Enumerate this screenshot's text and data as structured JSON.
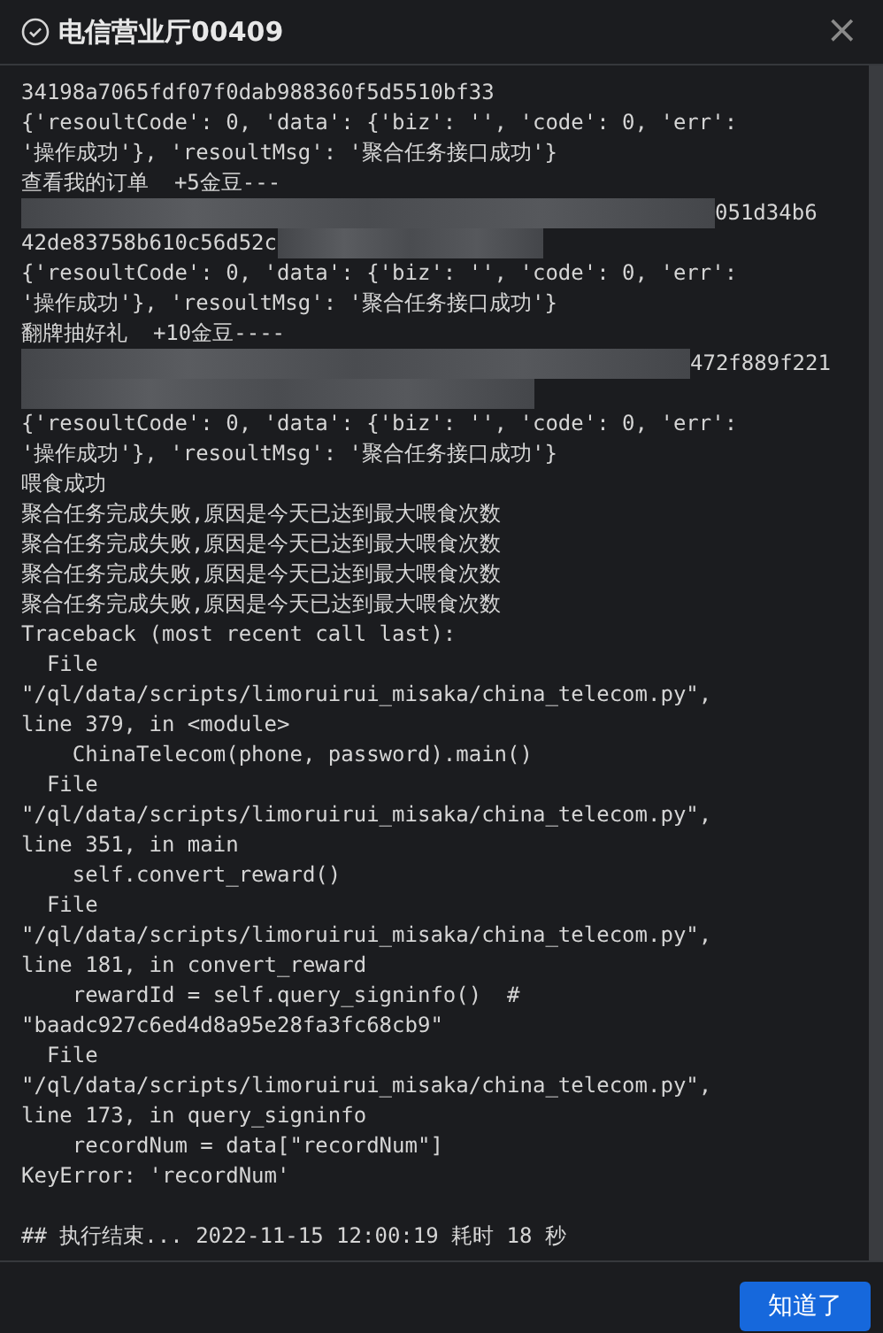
{
  "dialog": {
    "title": "电信营业厅00409",
    "close": "×"
  },
  "log": [
    {
      "kind": "text",
      "text": "34198a7065fdf07f0dab988360f5d5510bf33"
    },
    {
      "kind": "text",
      "text": "{'resoultCode': 0, 'data': {'biz': '', 'code': 0, 'err':"
    },
    {
      "kind": "text",
      "text": "'操作成功'}, 'resoultMsg': '聚合任务接口成功'}"
    },
    {
      "kind": "text",
      "text": "查看我的订单  +5金豆---"
    },
    {
      "kind": "redacted",
      "after": "051d34b6"
    },
    {
      "kind": "redacted",
      "before": "42de83758b610c56d52c"
    },
    {
      "kind": "text",
      "text": "{'resoultCode': 0, 'data': {'biz': '', 'code': 0, 'err':"
    },
    {
      "kind": "text",
      "text": "'操作成功'}, 'resoultMsg': '聚合任务接口成功'}"
    },
    {
      "kind": "text",
      "text": "翻牌抽好礼  +10金豆----"
    },
    {
      "kind": "redacted",
      "after": "472f889f221"
    },
    {
      "kind": "redacted"
    },
    {
      "kind": "text",
      "text": "{'resoultCode': 0, 'data': {'biz': '', 'code': 0, 'err':"
    },
    {
      "kind": "text",
      "text": "'操作成功'}, 'resoultMsg': '聚合任务接口成功'}"
    },
    {
      "kind": "text",
      "text": "喂食成功"
    },
    {
      "kind": "text",
      "text": "聚合任务完成失败,原因是今天已达到最大喂食次数"
    },
    {
      "kind": "text",
      "text": "聚合任务完成失败,原因是今天已达到最大喂食次数"
    },
    {
      "kind": "text",
      "text": "聚合任务完成失败,原因是今天已达到最大喂食次数"
    },
    {
      "kind": "text",
      "text": "聚合任务完成失败,原因是今天已达到最大喂食次数"
    },
    {
      "kind": "text",
      "text": "Traceback (most recent call last):"
    },
    {
      "kind": "text",
      "text": "  File"
    },
    {
      "kind": "text",
      "text": "\"/ql/data/scripts/limoruirui_misaka/china_telecom.py\","
    },
    {
      "kind": "text",
      "text": "line 379, in <module>"
    },
    {
      "kind": "text",
      "text": "    ChinaTelecom(phone, password).main()"
    },
    {
      "kind": "text",
      "text": "  File"
    },
    {
      "kind": "text",
      "text": "\"/ql/data/scripts/limoruirui_misaka/china_telecom.py\","
    },
    {
      "kind": "text",
      "text": "line 351, in main"
    },
    {
      "kind": "text",
      "text": "    self.convert_reward()"
    },
    {
      "kind": "text",
      "text": "  File"
    },
    {
      "kind": "text",
      "text": "\"/ql/data/scripts/limoruirui_misaka/china_telecom.py\","
    },
    {
      "kind": "text",
      "text": "line 181, in convert_reward"
    },
    {
      "kind": "text",
      "text": "    rewardId = self.query_signinfo()  #"
    },
    {
      "kind": "text",
      "text": "\"baadc927c6ed4d8a95e28fa3fc68cb9\""
    },
    {
      "kind": "text",
      "text": "  File"
    },
    {
      "kind": "text",
      "text": "\"/ql/data/scripts/limoruirui_misaka/china_telecom.py\","
    },
    {
      "kind": "text",
      "text": "line 173, in query_signinfo"
    },
    {
      "kind": "text",
      "text": "    recordNum = data[\"recordNum\"]"
    },
    {
      "kind": "text",
      "text": "KeyError: 'recordNum'"
    },
    {
      "kind": "blank"
    },
    {
      "kind": "text",
      "text": "## 执行结束... 2022-11-15 12:00:19 耗时 18 秒"
    }
  ],
  "buttons": [
    {
      "label": "知道了"
    }
  ]
}
